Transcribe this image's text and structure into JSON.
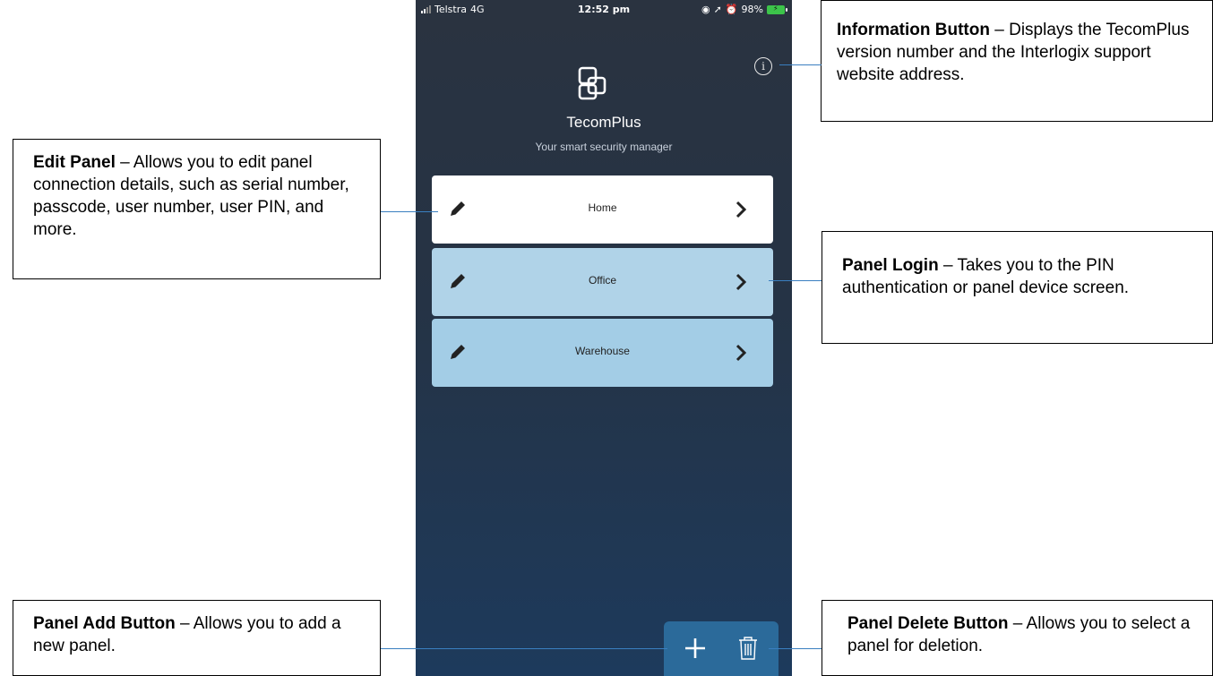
{
  "status_bar": {
    "carrier": "Telstra",
    "network": "4G",
    "time": "12:52 pm",
    "battery_percent": "98%"
  },
  "app": {
    "title": "TecomPlus",
    "subtitle": "Your smart security manager",
    "info_symbol": "i"
  },
  "panels": [
    {
      "name": "Home",
      "color": "#ffffff"
    },
    {
      "name": "Office",
      "color": "#b0d3e8"
    },
    {
      "name": "Warehouse",
      "color": "#a3cde6"
    }
  ],
  "icons": {
    "edit": "pencil-icon",
    "login": "chevron-right-icon",
    "add": "plus-icon",
    "delete": "trash-icon",
    "info": "info-icon"
  },
  "callouts": {
    "info": {
      "title": "Information Button",
      "text": " – Displays the TecomPlus version number and the Interlogix support website address."
    },
    "edit": {
      "title": "Edit Panel",
      "text": " – Allows you to edit panel connection details, such as serial number, passcode, user number, user PIN, and more."
    },
    "login": {
      "title": "Panel Login",
      "text": " – Takes you to the PIN authentication or panel device screen."
    },
    "add": {
      "title": "Panel Add Button",
      "text": " – Allows you to add a new panel."
    },
    "delete": {
      "title": "Panel Delete Button",
      "text": " – Allows you to select a panel for deletion."
    }
  },
  "colors": {
    "toolbar": "#2b6a9a",
    "leader_line": "#3a7fc0"
  }
}
